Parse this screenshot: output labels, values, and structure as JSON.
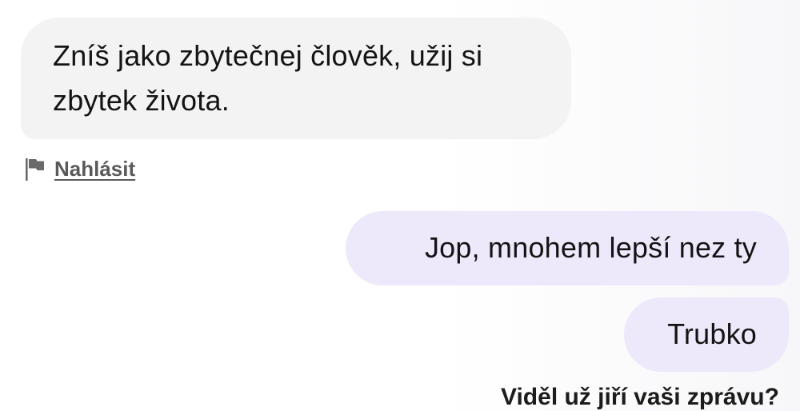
{
  "chat": {
    "incoming": {
      "text_line_1": "Zníš jako zbytečnej člověk, užij si",
      "text_line_2": "zbytek života."
    },
    "report": {
      "icon": "flag-icon",
      "label": "Nahlásit"
    },
    "outgoing": [
      {
        "text": "Jop, mnohem lepší nez ty"
      },
      {
        "text": "Trubko"
      }
    ],
    "footer_prompt": "Viděl už jiří vaši zprávu?"
  },
  "colors": {
    "incoming_bubble": "#f3f3f3",
    "outgoing_bubble": "#eee8fb",
    "text": "#141414",
    "link": "#5a5a5a"
  }
}
